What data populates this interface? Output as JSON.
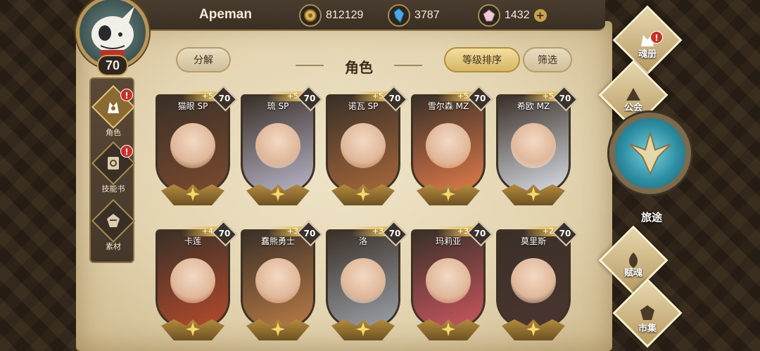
{
  "player": {
    "name": "Apeman",
    "level": "70"
  },
  "currencies": [
    {
      "icon": "gold-coin-icon",
      "value": "812129"
    },
    {
      "icon": "blue-crystal-icon",
      "value": "3787"
    },
    {
      "icon": "pink-gem-icon",
      "value": "1432"
    }
  ],
  "header": {
    "title": "角色",
    "decompose_label": "分解",
    "sort_label": "等级排序",
    "filter_label": "筛选"
  },
  "left_menu": [
    {
      "label": "角色",
      "icon": "character-icon",
      "alert": "!"
    },
    {
      "label": "技能书",
      "icon": "skill-book-icon",
      "alert": "!"
    },
    {
      "label": "素材",
      "icon": "material-icon"
    }
  ],
  "right_menu": {
    "soul_book": {
      "label": "魂册",
      "alert": "!"
    },
    "guild": {
      "label": "公会"
    },
    "journey": {
      "label": "旅途"
    },
    "endow_soul": {
      "label": "赋魂"
    },
    "market": {
      "label": "市集"
    }
  },
  "characters": [
    {
      "name": "猫眼 SP",
      "plus": "+5",
      "level": "70",
      "color": "#7a4a2e"
    },
    {
      "name": "琉 SP",
      "plus": "+5",
      "level": "70",
      "color": "#b8b4c8"
    },
    {
      "name": "诺瓦 SP",
      "plus": "+5",
      "level": "70",
      "color": "#a6683a"
    },
    {
      "name": "雪尔森 MZ",
      "plus": "+5",
      "level": "70",
      "color": "#e07a4a"
    },
    {
      "name": "希欧 MZ",
      "plus": "+5",
      "level": "70",
      "color": "#d8dce4"
    },
    {
      "name": "卡莲",
      "plus": "+4",
      "level": "70",
      "color": "#b34a2c"
    },
    {
      "name": "蠢熊勇士",
      "plus": "+3",
      "level": "70",
      "color": "#b97a44"
    },
    {
      "name": "洛",
      "plus": "+3",
      "level": "70",
      "color": "#9aa0a8"
    },
    {
      "name": "玛莉亚",
      "plus": "+3",
      "level": "70",
      "color": "#c8565e"
    },
    {
      "name": "莫里斯",
      "plus": "+2",
      "level": "70",
      "color": "#4a3530"
    }
  ]
}
